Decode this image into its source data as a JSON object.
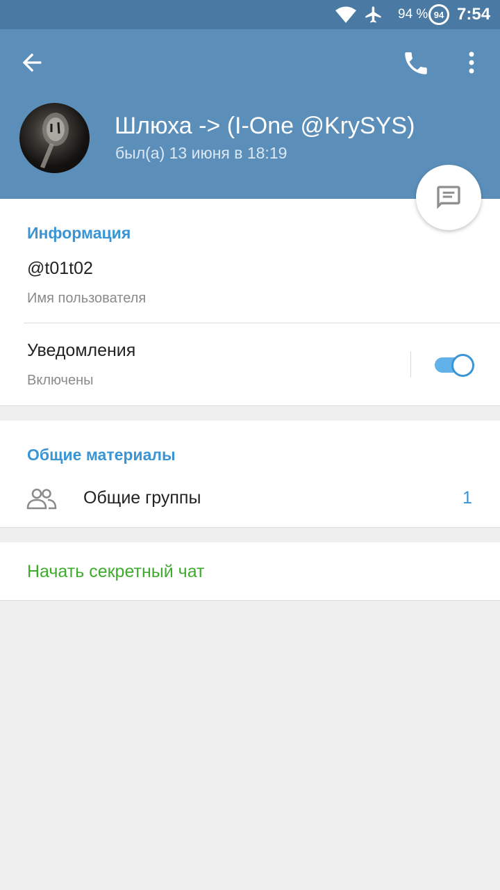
{
  "status_bar": {
    "battery_percent": "94 %",
    "battery_ring": "94",
    "time": "7:54",
    "icons": [
      "wifi-icon",
      "airplane-icon",
      "battery-icon"
    ]
  },
  "header": {
    "name": "Шлюха -> (I-One @KrySYS)",
    "last_seen": "был(а) 13 июня в 18:19",
    "icons": [
      "back-arrow-icon",
      "phone-icon",
      "more-vert-icon",
      "avatar-image",
      "message-icon"
    ]
  },
  "info": {
    "title": "Информация",
    "username": "@t01t02",
    "username_label": "Имя пользователя",
    "notifications_label": "Уведомления",
    "notifications_state": "Включены",
    "notifications_enabled": true
  },
  "shared": {
    "title": "Общие материалы",
    "groups_label": "Общие группы",
    "groups_count": "1",
    "groups_icon": "groups-icon"
  },
  "secret_chat": {
    "label": "Начать секретный чат"
  },
  "colors": {
    "status_bar": "#4a7aa3",
    "header": "#5b8fba",
    "accent": "#3a95d5",
    "secret_chat": "#3fab2d",
    "background": "#efefef"
  }
}
